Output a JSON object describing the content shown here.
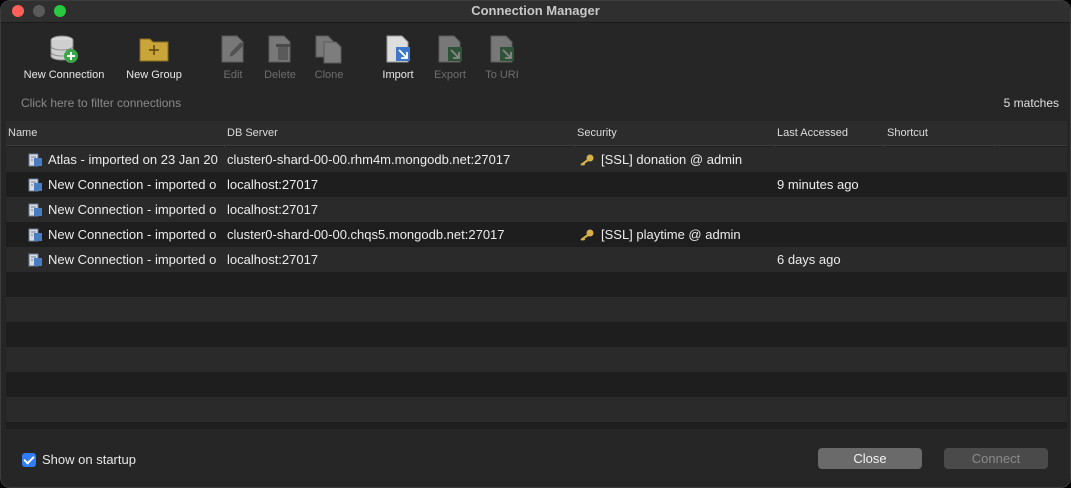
{
  "window": {
    "title": "Connection Manager"
  },
  "toolbar": {
    "new_connection": "New Connection",
    "new_group": "New Group",
    "edit": "Edit",
    "delete": "Delete",
    "clone": "Clone",
    "import": "Import",
    "export": "Export",
    "to_uri": "To URI"
  },
  "filter": {
    "placeholder": "Click here to filter connections",
    "matches": "5 matches"
  },
  "table": {
    "columns": {
      "name": "Name",
      "server": "DB Server",
      "security": "Security",
      "last_accessed": "Last Accessed",
      "shortcut": "Shortcut"
    },
    "rows": [
      {
        "name": "Atlas - imported on 23 Jan 20",
        "server": "cluster0-shard-00-00.rhm4m.mongodb.net:27017",
        "security": "[SSL] donation @ admin",
        "last_accessed": ""
      },
      {
        "name": "New Connection - imported o",
        "server": "localhost:27017",
        "security": "",
        "last_accessed": "9 minutes ago"
      },
      {
        "name": "New Connection - imported o",
        "server": "localhost:27017",
        "security": "",
        "last_accessed": ""
      },
      {
        "name": "New Connection - imported o",
        "server": "cluster0-shard-00-00.chqs5.mongodb.net:27017",
        "security": "[SSL] playtime @ admin",
        "last_accessed": ""
      },
      {
        "name": "New Connection - imported o",
        "server": "localhost:27017",
        "security": "",
        "last_accessed": "6 days ago"
      }
    ]
  },
  "footer": {
    "show_on_startup": "Show on startup",
    "show_on_startup_checked": true,
    "close": "Close",
    "connect": "Connect"
  },
  "colors": {
    "accent": "#2f7cf6",
    "background": "#262626",
    "row_alt": "#2a2a2a"
  }
}
